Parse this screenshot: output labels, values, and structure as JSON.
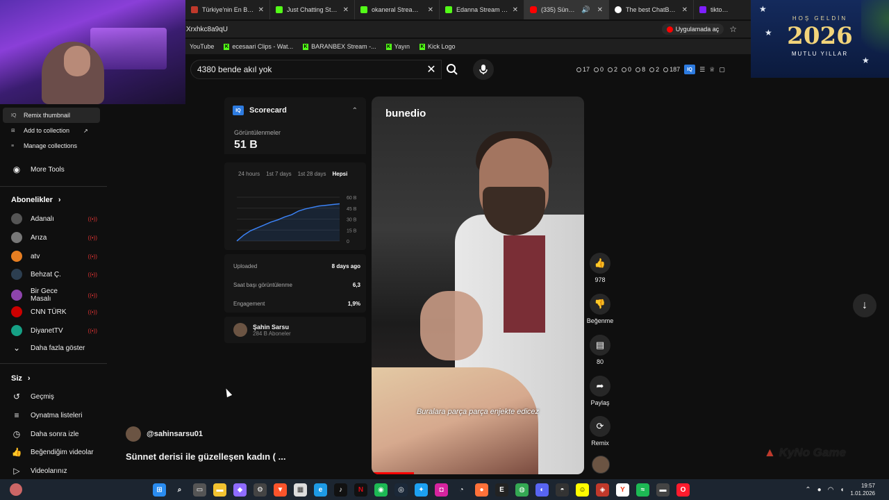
{
  "tabs": [
    {
      "title": "Türkiye'nin En Büyük",
      "color": "#c0392b"
    },
    {
      "title": "Just Chatting Stream",
      "color": "#53fc18"
    },
    {
      "title": "okaneral Stream - Wa",
      "color": "#53fc18"
    },
    {
      "title": "Edanna Stream - Wat",
      "color": "#53fc18"
    },
    {
      "title": "(335) Sünnet deri",
      "color": "#ff0000"
    },
    {
      "title": "The best ChatBot anc",
      "color": "#ffffff"
    },
    {
      "title": "tiktok - Yahoo",
      "color": "#7e1fff"
    }
  ],
  "address": {
    "url": "Xrxhkc8a9qU",
    "open_app": "Uygulamada aç"
  },
  "bookmarks": [
    "YouTube",
    "ecesaari Clips - Wat...",
    "BARANBEX Stream -...",
    "Yayın",
    "Kick Logo"
  ],
  "banner": {
    "greeting": "HOŞ GELDİN",
    "year": "2026",
    "wish": "MUTLU YILLAR"
  },
  "search": {
    "query": "4380 bende akıl yok"
  },
  "stats": [
    "17",
    "0",
    "2",
    "0",
    "8",
    "2",
    "187"
  ],
  "context_menu": [
    {
      "label": "Remix thumbnail",
      "icon": "iq-icon"
    },
    {
      "label": "Add to collection",
      "icon": "collection-icon"
    },
    {
      "label": "Manage collections",
      "icon": "manage-icon"
    }
  ],
  "sidebar": {
    "more_tools": "More Tools",
    "subs_heading": "Abonelikler",
    "subscriptions": [
      {
        "name": "Adanalı",
        "color": "#555"
      },
      {
        "name": "Arıza",
        "color": "#777"
      },
      {
        "name": "atv",
        "color": "#e67e22"
      },
      {
        "name": "Behzat Ç.",
        "color": "#2c3e50"
      },
      {
        "name": "Bir Gece Masalı",
        "color": "#8e44ad"
      },
      {
        "name": "CNN TÜRK",
        "color": "#cc0000"
      },
      {
        "name": "DiyanetTV",
        "color": "#16a085"
      }
    ],
    "show_more": "Daha fazla göster",
    "you_heading": "Siz",
    "you_items": [
      {
        "label": "Geçmiş",
        "icon": "history-icon"
      },
      {
        "label": "Oynatma listeleri",
        "icon": "playlist-icon"
      },
      {
        "label": "Daha sonra izle",
        "icon": "clock-icon"
      },
      {
        "label": "Beğendiğim videolar",
        "icon": "thumb-up-icon"
      },
      {
        "label": "Videolarınız",
        "icon": "video-icon"
      }
    ]
  },
  "scorecard": {
    "title": "Scorecard",
    "views_label": "Görüntülenmeler",
    "views_value": "51 B",
    "periods": [
      "24 hours",
      "1st 7 days",
      "1st 28 days",
      "Hepsi"
    ],
    "active_period": "Hepsi",
    "metrics": [
      {
        "label": "Uploaded",
        "value": "8 days ago"
      },
      {
        "label": "Saat başı görüntülenme",
        "value": "6,3"
      },
      {
        "label": "Engagement",
        "value": "1,9%"
      }
    ],
    "owner_name": "Şahin Sarsu",
    "owner_subs": "284 B Aboneler"
  },
  "chart_data": {
    "type": "line",
    "x": [
      0,
      1,
      2,
      3,
      4,
      5,
      6,
      7,
      8,
      9,
      10,
      11,
      12,
      13,
      14,
      15
    ],
    "y": [
      0,
      8,
      14,
      18,
      22,
      26,
      29,
      33,
      36,
      41,
      44,
      46,
      48,
      49,
      50,
      51
    ],
    "yticks": [
      "60 B",
      "45 B",
      "30 B",
      "15 B",
      "0"
    ],
    "ylim": [
      0,
      60
    ]
  },
  "video": {
    "brand": "bunedio",
    "caption": "Buralara parça parça enjekte edicez",
    "progress": 0.2
  },
  "actions": [
    {
      "label": "978",
      "icon": "thumb-up-icon"
    },
    {
      "label": "Beğenme",
      "icon": "thumb-down-icon"
    },
    {
      "label": "80",
      "icon": "comment-icon"
    },
    {
      "label": "Paylaş",
      "icon": "share-icon"
    },
    {
      "label": "Remix",
      "icon": "remix-icon"
    }
  ],
  "channel": {
    "handle": "@sahinsarsu01",
    "title": "Sünnet derisi ile güzelleşen kadın ( ..."
  },
  "watermark": "KyNo Game",
  "clock": {
    "time": "19:57",
    "date": "1.01.2026"
  }
}
